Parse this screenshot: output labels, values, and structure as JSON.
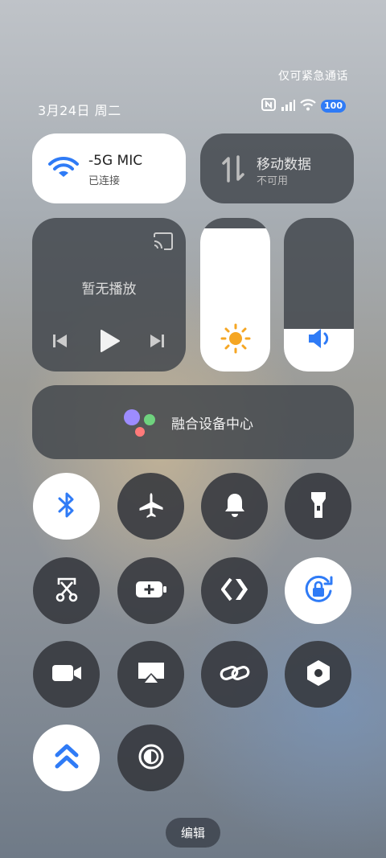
{
  "status": {
    "emergency_only": "仅可紧急通话",
    "date": "3月24日 周二",
    "battery": "100"
  },
  "wifi": {
    "ssid": "-5G      MIC",
    "status": "已连接"
  },
  "mobile_data": {
    "title": "移动数据",
    "status": "不可用"
  },
  "media": {
    "no_playback": "暂无播放"
  },
  "brightness": {
    "level": 0.93
  },
  "volume": {
    "level": 0.28
  },
  "device_hub": {
    "label": "融合设备中心"
  },
  "toggles": [
    {
      "name": "bluetooth",
      "active": true
    },
    {
      "name": "airplane-mode",
      "active": false
    },
    {
      "name": "ringer",
      "active": false
    },
    {
      "name": "flashlight",
      "active": false
    },
    {
      "name": "screenshot",
      "active": false
    },
    {
      "name": "battery-saver",
      "active": false
    },
    {
      "name": "nearby-share",
      "active": false
    },
    {
      "name": "rotation-lock",
      "active": true
    },
    {
      "name": "screen-record",
      "active": false
    },
    {
      "name": "screen-cast",
      "active": false
    },
    {
      "name": "link",
      "active": false
    },
    {
      "name": "settings-hex",
      "active": false
    },
    {
      "name": "performance-mode",
      "active": true
    },
    {
      "name": "dark-mode",
      "active": false
    }
  ],
  "colors": {
    "accent": "#2f7bf6",
    "sun": "#f5a623"
  },
  "edit_label": "编辑"
}
